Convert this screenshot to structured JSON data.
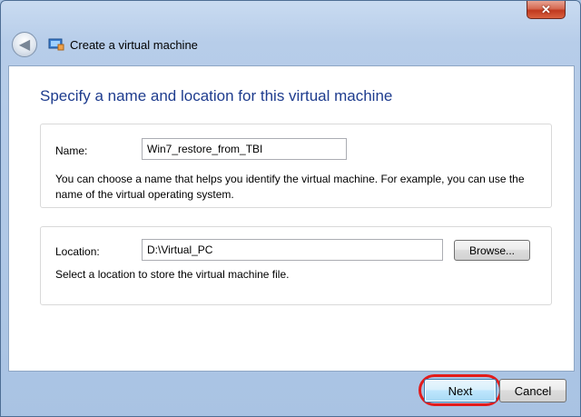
{
  "window": {
    "title": "Create a virtual machine",
    "close_glyph": "✕",
    "back_glyph": "◀"
  },
  "page": {
    "heading": "Specify a name and location for this virtual machine"
  },
  "name_section": {
    "label": "Name:",
    "value": "Win7_restore_from_TBI",
    "description": "You can choose a name that helps you identify the virtual machine. For example, you can use the name of the virtual operating system."
  },
  "location_section": {
    "label": "Location:",
    "value": "D:\\Virtual_PC",
    "browse_label": "Browse...",
    "description": "Select a location to store the virtual machine file."
  },
  "footer": {
    "next_label": "Next",
    "cancel_label": "Cancel"
  },
  "colors": {
    "heading": "#1e3c8e",
    "highlight_ring": "#e21b1b",
    "close_button": "#c0391f"
  }
}
